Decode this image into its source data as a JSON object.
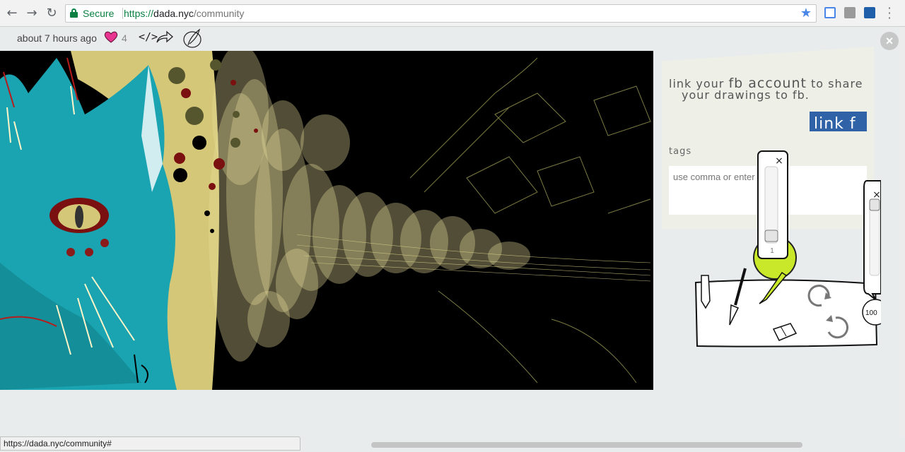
{
  "browser": {
    "secure_label": "Secure",
    "url_scheme": "https://",
    "url_host": "dada.nyc",
    "url_path": "/community",
    "status_url": "https://dada.nyc/community#"
  },
  "post": {
    "time": "about 7 hours ago",
    "likes": "4"
  },
  "panel": {
    "fb_text_1": "link your ",
    "fb_text_big": "fb account",
    "fb_text_2": " to share",
    "fb_text_3": "your drawings to fb.",
    "link_button": "link f",
    "tags_label": "tags",
    "tags_placeholder": "use comma or enter"
  },
  "tools": {
    "size_value": "1",
    "zoom_label": "100"
  },
  "colors": {
    "accent_green": "#c9e82a",
    "fb_blue": "#2f62a6",
    "secure_green": "#0b8043",
    "heart_pink": "#e8358f"
  },
  "icons": [
    "back-icon",
    "forward-icon",
    "reload-icon",
    "lock-icon",
    "star-icon",
    "embed-icon",
    "share-icon",
    "feather-icon",
    "heart-icon",
    "close-icon",
    "pencil-icon",
    "brush-icon",
    "marker-icon",
    "undo-icon",
    "redo-icon",
    "eraser-icon"
  ]
}
